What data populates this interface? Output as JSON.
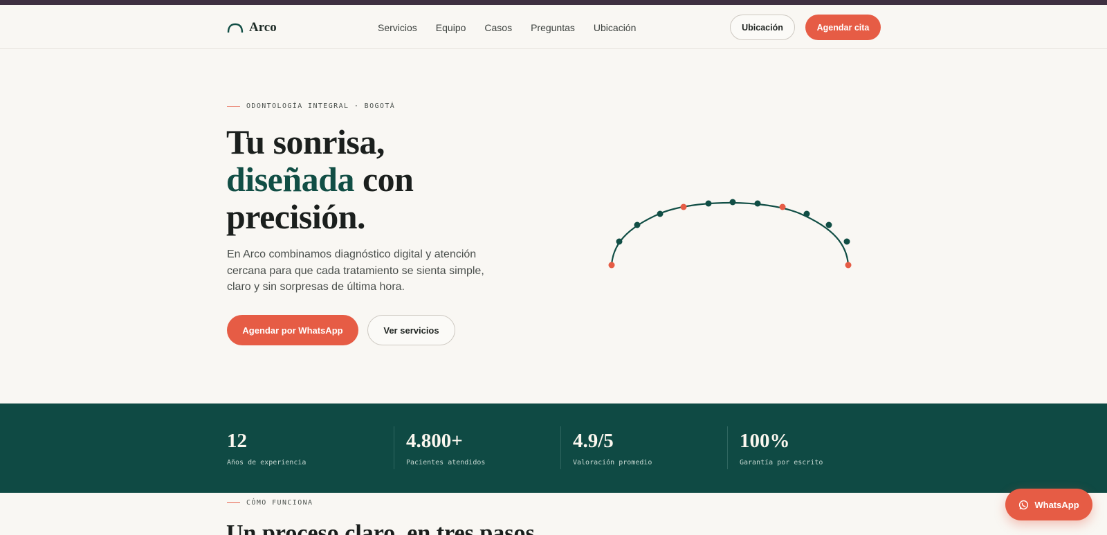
{
  "brand": {
    "name": "Arco"
  },
  "nav": {
    "items": [
      {
        "label": "Servicios"
      },
      {
        "label": "Equipo"
      },
      {
        "label": "Casos"
      },
      {
        "label": "Preguntas"
      },
      {
        "label": "Ubicación"
      }
    ],
    "location_button": "Ubicación",
    "cta_button": "Agendar cita"
  },
  "hero": {
    "eyebrow": "ODONTOLOGÍA INTEGRAL · BOGOTÁ",
    "title_line1": "Tu sonrisa,",
    "title_accent": "diseñada",
    "title_line2_rest": " con",
    "title_line3": "precisión.",
    "subtitle": "En Arco combinamos diagnóstico digital y atención cercana para que cada tratamiento se sienta simple, claro y sin sorpresas de última hora.",
    "primary_button": "Agendar por WhatsApp",
    "secondary_button": "Ver servicios"
  },
  "stats": [
    {
      "value": "12",
      "label": "Años de experiencia"
    },
    {
      "value": "4.800+",
      "label": "Pacientes atendidos"
    },
    {
      "value": "4.9/5",
      "label": "Valoración promedio"
    },
    {
      "value": "100%",
      "label": "Garantía por escrito"
    }
  ],
  "process": {
    "eyebrow": "CÓMO FUNCIONA",
    "title": "Un proceso claro, en tres pasos."
  },
  "whatsapp_float": {
    "label": "WhatsApp",
    "icon": "whatsapp-icon"
  },
  "colors": {
    "accent": "#e65c45",
    "brand_green": "#0f4a44",
    "background": "#f9f7f3",
    "top_bar": "#3f3041"
  }
}
